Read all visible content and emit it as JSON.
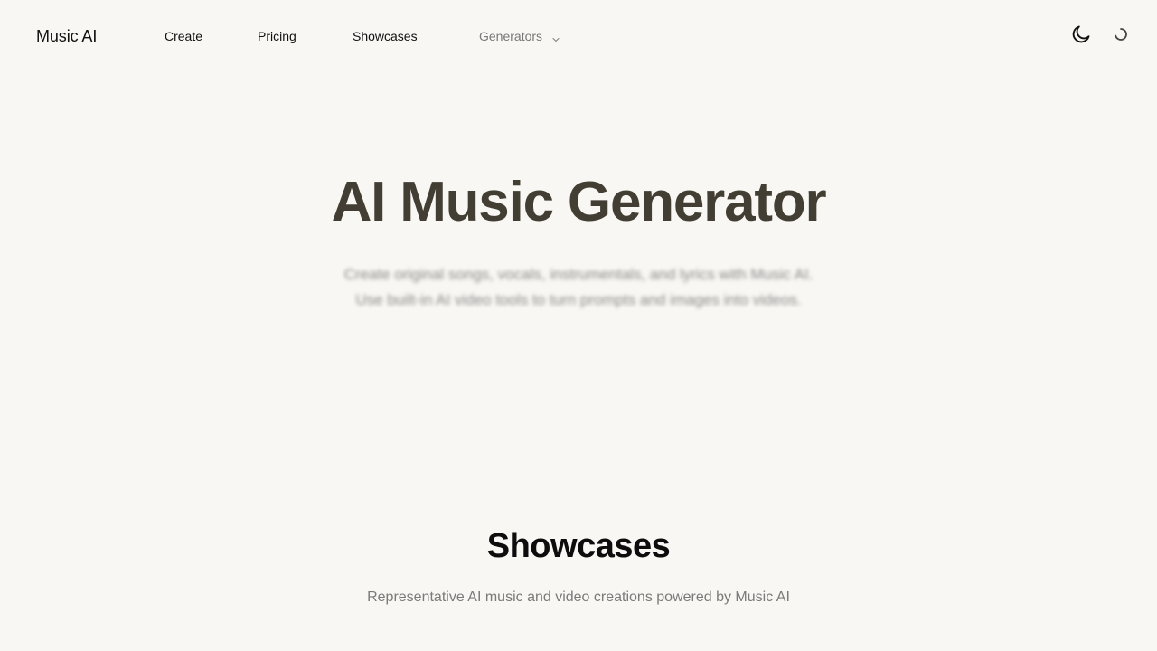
{
  "header": {
    "brand": "Music AI",
    "nav": {
      "create": "Create",
      "pricing": "Pricing",
      "showcases": "Showcases",
      "generators": "Generators"
    },
    "icons": {
      "theme_toggle": "moon-icon",
      "loading": "spinner-icon",
      "generators_dropdown": "chevron-down-icon"
    }
  },
  "hero": {
    "title": "AI Music Generator",
    "subtitle_line1": "Create original songs, vocals, instrumentals, and lyrics with Music AI.",
    "subtitle_line2": "Use built-in AI video tools to turn prompts and images into videos."
  },
  "showcases": {
    "title": "Showcases",
    "subtitle": "Representative AI music and video creations powered by Music AI"
  },
  "colors": {
    "background": "#f9f7f3",
    "hero_title": "#433e34",
    "muted_text": "#7a7a7a"
  }
}
